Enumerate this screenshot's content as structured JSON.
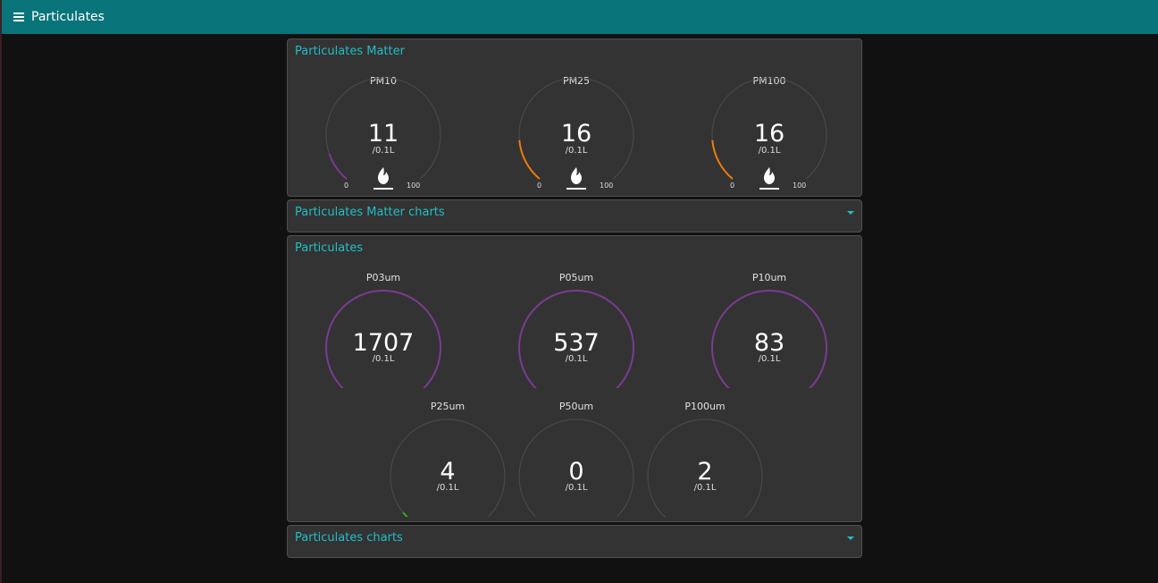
{
  "app": {
    "title": "Particulates"
  },
  "colors": {
    "accent": "#1fbfc7",
    "header": "#097479",
    "track": "#4d4d4d"
  },
  "groups": {
    "pm": {
      "title": "Particulates Matter",
      "gauges": [
        {
          "label": "PM10",
          "value": "11",
          "unit": "/0.1L",
          "min": "0",
          "max": "100",
          "fraction": 0.11,
          "color": "#7b3b8f",
          "icon": "fire-icon"
        },
        {
          "label": "PM25",
          "value": "16",
          "unit": "/0.1L",
          "min": "0",
          "max": "100",
          "fraction": 0.16,
          "color": "#f07d0a",
          "icon": "fire-icon"
        },
        {
          "label": "PM100",
          "value": "16",
          "unit": "/0.1L",
          "min": "0",
          "max": "100",
          "fraction": 0.16,
          "color": "#f07d0a",
          "icon": "fire-icon"
        }
      ]
    },
    "pm_charts": {
      "title": "Particulates Matter charts"
    },
    "particulates": {
      "title": "Particulates",
      "gauges": [
        {
          "label": "P03um",
          "value": "1707",
          "unit": "/0.1L",
          "fraction": 1.0,
          "color": "#7b3b8f"
        },
        {
          "label": "P05um",
          "value": "537",
          "unit": "/0.1L",
          "fraction": 1.0,
          "color": "#7b3b8f"
        },
        {
          "label": "P10um",
          "value": "83",
          "unit": "/0.1L",
          "fraction": 1.0,
          "color": "#7b3b8f"
        },
        {
          "label": "P25um",
          "value": "4",
          "unit": "/0.1L",
          "fraction": 0.04,
          "color": "#3fa030"
        },
        {
          "label": "P50um",
          "value": "0",
          "unit": "/0.1L",
          "fraction": 0.0,
          "color": "#3fa030"
        },
        {
          "label": "P100um",
          "value": "2",
          "unit": "/0.1L",
          "fraction": 0.02,
          "color": "#3fa030"
        }
      ]
    },
    "particulates_charts": {
      "title": "Particulates charts"
    }
  }
}
